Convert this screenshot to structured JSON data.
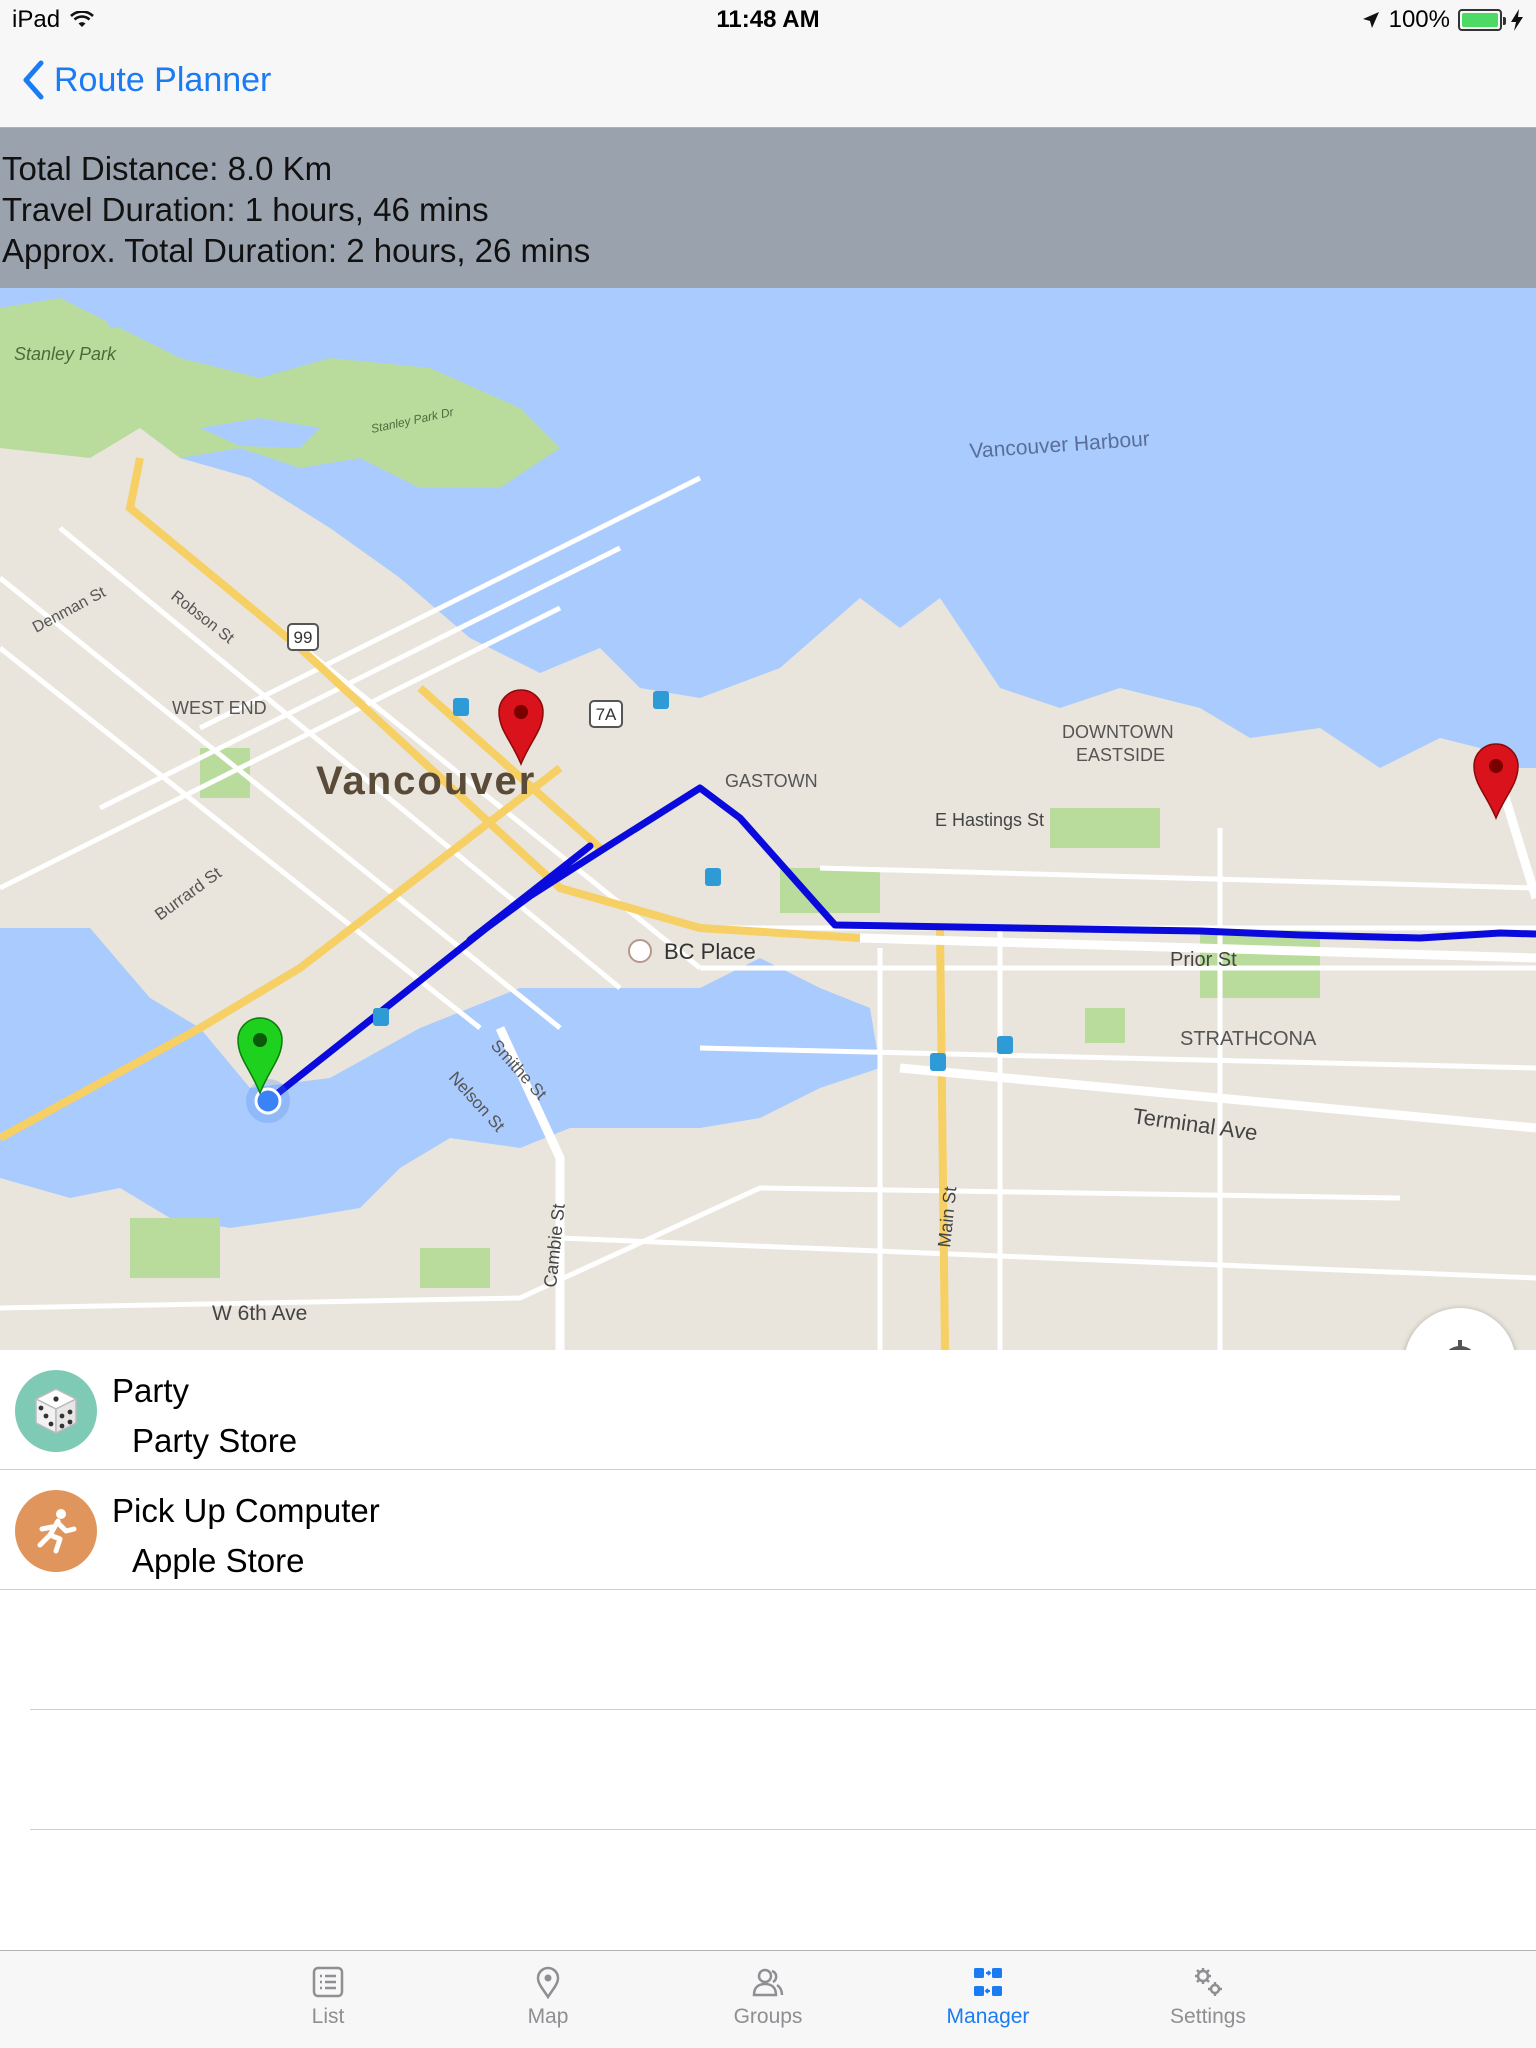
{
  "status_bar": {
    "device": "iPad",
    "time": "11:48 AM",
    "battery": "100%",
    "battery_level": 1.0
  },
  "nav": {
    "back_label": "Route Planner"
  },
  "summary": {
    "distance": "Total Distance: 8.0 Km",
    "travel": "Travel Duration: 1 hours, 46 mins",
    "total": "Approx. Total Duration: 2 hours, 26 mins"
  },
  "map": {
    "labels": {
      "stanley_park": "Stanley Park",
      "stanley_park_dr": "Stanley Park Dr",
      "harbour": "Vancouver Harbour",
      "denman": "Denman St",
      "robson": "Robson St",
      "west_end": "WEST END",
      "city": "Vancouver",
      "gastown": "GASTOWN",
      "downtown_eastside_1": "DOWNTOWN",
      "downtown_eastside_2": "EASTSIDE",
      "hastings": "E Hastings St",
      "burrard": "Burrard St",
      "smithe": "Smithe St",
      "nelson": "Nelson St",
      "bc_place": "BC Place",
      "prior": "Prior St",
      "strathcona": "STRATHCONA",
      "terminal": "Terminal Ave",
      "cambie": "Cambie St",
      "main": "Main St",
      "w6th": "W 6th Ave",
      "hwy99": "99",
      "hwy7a": "7A"
    },
    "colors": {
      "water": "#aacbfd",
      "land": "#e9e5dc",
      "park": "#b9dc9c",
      "route": "#0a0adc",
      "major_road": "#f6cf65",
      "pin_red": "#d9121b",
      "pin_green": "#1fd11f"
    }
  },
  "tasks": [
    {
      "title": "Party",
      "location": "Party Store",
      "icon": "dice-icon",
      "color": "#7ecab5"
    },
    {
      "title": "Pick Up Computer",
      "location": "Apple Store",
      "icon": "running-person-icon",
      "color": "#e0955c"
    }
  ],
  "tabs": [
    {
      "label": "List",
      "icon": "list-icon",
      "active": false
    },
    {
      "label": "Map",
      "icon": "map-pin-icon",
      "active": false
    },
    {
      "label": "Groups",
      "icon": "groups-icon",
      "active": false
    },
    {
      "label": "Manager",
      "icon": "manager-icon",
      "active": true
    },
    {
      "label": "Settings",
      "icon": "gears-icon",
      "active": false
    }
  ]
}
